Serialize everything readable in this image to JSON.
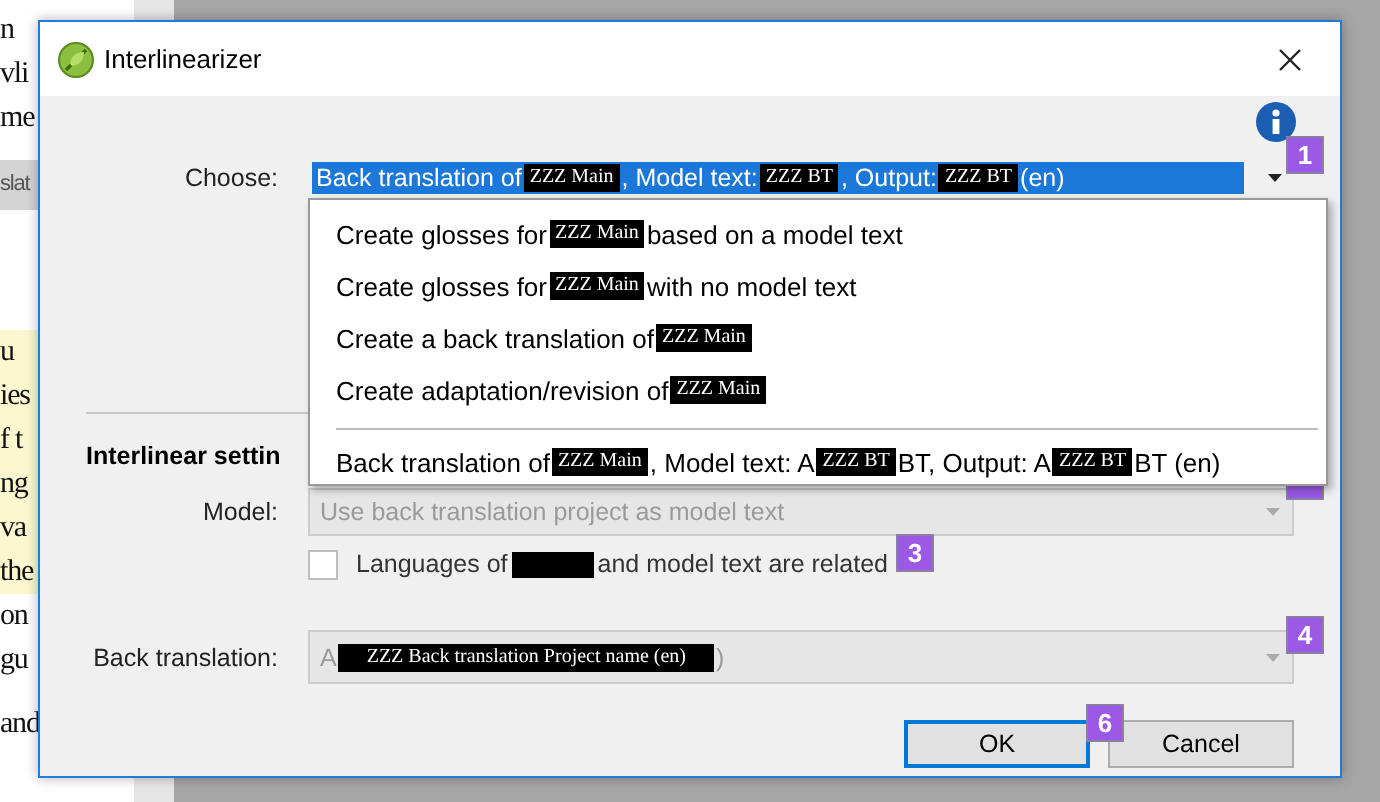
{
  "background_document": {
    "fragments": [
      {
        "text": "n",
        "kind": "plain"
      },
      {
        "text": "vli",
        "kind": "plain"
      },
      {
        "text": "me",
        "kind": "plain"
      },
      {
        "text": "slat",
        "kind": "bar"
      },
      {
        "text": "u",
        "kind": "highlight"
      },
      {
        "text": "ies",
        "kind": "highlight"
      },
      {
        "text": "f t",
        "kind": "highlight"
      },
      {
        "text": "ng",
        "kind": "highlight"
      },
      {
        "text": "va",
        "kind": "highlight"
      },
      {
        "text": "the",
        "kind": "highlight"
      },
      {
        "text": "on",
        "kind": "plain"
      },
      {
        "text": "gu",
        "kind": "plain"
      },
      {
        "text": "and",
        "kind": "plain"
      }
    ]
  },
  "window": {
    "title": "Interlinearizer"
  },
  "choose": {
    "label": "Choose:",
    "badge": "1",
    "value": [
      {
        "kind": "text",
        "text": "Back translation of "
      },
      {
        "kind": "redacted",
        "text": "ZZZ Main"
      },
      {
        "kind": "text",
        "text": ", Model text: "
      },
      {
        "kind": "redacted",
        "text": "ZZZ BT"
      },
      {
        "kind": "text",
        "text": ", Output: "
      },
      {
        "kind": "redacted",
        "text": "ZZZ BT"
      },
      {
        "kind": "text",
        "text": " (en)"
      }
    ]
  },
  "dropdown": {
    "items": [
      {
        "kind": "option",
        "selected": false,
        "parts": [
          {
            "kind": "text",
            "text": "Create glosses for "
          },
          {
            "kind": "redacted",
            "text": "ZZZ Main"
          },
          {
            "kind": "text",
            "text": " based on a model text"
          }
        ]
      },
      {
        "kind": "option",
        "selected": false,
        "parts": [
          {
            "kind": "text",
            "text": "Create glosses for "
          },
          {
            "kind": "redacted",
            "text": "ZZZ Main"
          },
          {
            "kind": "text",
            "text": " with no model text"
          }
        ]
      },
      {
        "kind": "option",
        "selected": false,
        "parts": [
          {
            "kind": "text",
            "text": "Create a back translation of "
          },
          {
            "kind": "redacted",
            "text": "ZZZ Main"
          }
        ]
      },
      {
        "kind": "option",
        "selected": false,
        "parts": [
          {
            "kind": "text",
            "text": "Create adaptation/revision of "
          },
          {
            "kind": "redacted",
            "text": "ZZZ Main"
          }
        ]
      },
      {
        "kind": "separator"
      },
      {
        "kind": "option",
        "selected": false,
        "parts": [
          {
            "kind": "text",
            "text": "Back translation of "
          },
          {
            "kind": "redacted",
            "text": "ZZZ Main"
          },
          {
            "kind": "text",
            "text": ", Model text: A"
          },
          {
            "kind": "redacted",
            "text": "ZZZ BT"
          },
          {
            "kind": "text",
            "text": "BT, Output: A"
          },
          {
            "kind": "redacted",
            "text": "ZZZ BT"
          },
          {
            "kind": "text",
            "text": "BT (en)"
          }
        ]
      }
    ]
  },
  "section": {
    "title": "Interlinear settin"
  },
  "model": {
    "label": "Model:",
    "value": "Use back translation project as model text",
    "disabled": true
  },
  "related": {
    "checked": false,
    "badge": "3",
    "parts": [
      {
        "kind": "text",
        "text": "Languages of "
      },
      {
        "kind": "blank"
      },
      {
        "kind": "text",
        "text": " and model text are related"
      }
    ]
  },
  "back_translation": {
    "label": "Back translation:",
    "disabled": true,
    "badge": "4",
    "parts": [
      {
        "kind": "text",
        "text": "A"
      },
      {
        "kind": "redacted",
        "text": "ZZZ Back translation Project name (en)"
      },
      {
        "kind": "text",
        "text": ")"
      }
    ]
  },
  "buttons": [
    {
      "label": "OK",
      "default": true
    },
    {
      "label": "Cancel",
      "default": false
    }
  ],
  "buttons_badge": "6"
}
